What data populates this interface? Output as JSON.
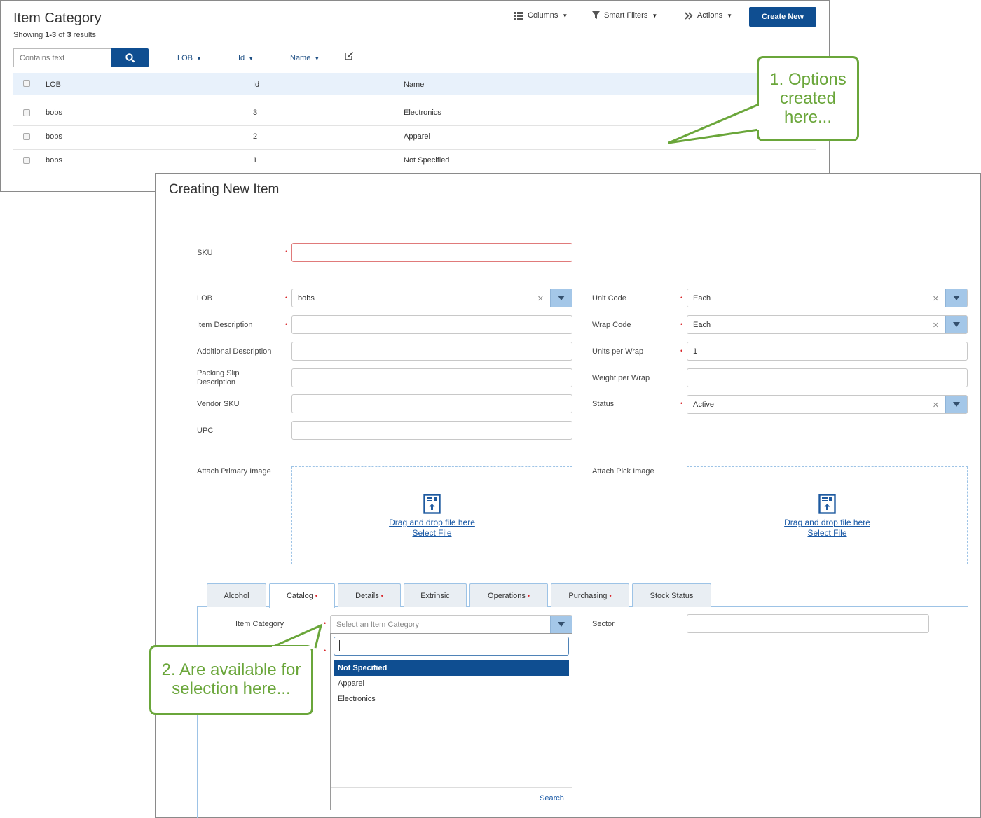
{
  "item_category": {
    "title": "Item Category",
    "showing_prefix": "Showing ",
    "showing_range": "1-3",
    "showing_mid": " of ",
    "showing_total": "3",
    "showing_suffix": " results",
    "toolbar": {
      "columns": "Columns",
      "smart_filters": "Smart Filters",
      "actions": "Actions",
      "create_new": "Create New"
    },
    "search": {
      "placeholder": "Contains text"
    },
    "filters": [
      "LOB",
      "Id",
      "Name"
    ],
    "columns": [
      "LOB",
      "Id",
      "Name"
    ],
    "rows": [
      {
        "lob": "bobs",
        "id": "3",
        "name": "Electronics"
      },
      {
        "lob": "bobs",
        "id": "2",
        "name": "Apparel"
      },
      {
        "lob": "bobs",
        "id": "1",
        "name": "Not Specified"
      }
    ]
  },
  "callouts": {
    "one": [
      "1. Options",
      "created",
      "here..."
    ],
    "two": [
      "2. Are available for",
      "selection here..."
    ]
  },
  "new_item": {
    "title": "Creating New Item",
    "fields": {
      "sku": {
        "label": "SKU",
        "value": ""
      },
      "lob": {
        "label": "LOB",
        "value": "bobs"
      },
      "item_description": {
        "label": "Item Description",
        "value": ""
      },
      "additional_description": {
        "label": "Additional Description",
        "value": ""
      },
      "packing_slip_description": {
        "label_line1": "Packing Slip",
        "label_line2": "Description",
        "value": ""
      },
      "vendor_sku": {
        "label": "Vendor SKU",
        "value": ""
      },
      "upc": {
        "label": "UPC",
        "value": ""
      },
      "unit_code": {
        "label": "Unit Code",
        "value": "Each"
      },
      "wrap_code": {
        "label": "Wrap Code",
        "value": "Each"
      },
      "units_per_wrap": {
        "label": "Units per Wrap",
        "value": "1"
      },
      "weight_per_wrap": {
        "label": "Weight per Wrap",
        "value": ""
      },
      "status": {
        "label": "Status",
        "value": "Active"
      },
      "primary_image": {
        "label": "Attach Primary Image",
        "drag_text": "Drag and drop file here ",
        "select_text": "Select File"
      },
      "pick_image": {
        "label": "Attach Pick Image",
        "drag_text": "Drag and drop file here ",
        "select_text": "Select File"
      }
    },
    "tabs": [
      {
        "label": "Alcohol",
        "required": false
      },
      {
        "label": "Catalog",
        "required": true
      },
      {
        "label": "Details",
        "required": true
      },
      {
        "label": "Extrinsic",
        "required": false
      },
      {
        "label": "Operations",
        "required": true
      },
      {
        "label": "Purchasing",
        "required": true
      },
      {
        "label": "Stock Status",
        "required": false
      }
    ],
    "active_tab": "Catalog",
    "catalog": {
      "item_category_label": "Item Category",
      "item_category_placeholder": "Select an Item Category",
      "sector_label": "Sector",
      "sector_value": "",
      "options": [
        "Not Specified",
        "Apparel",
        "Electronics"
      ],
      "selected_option": "Not Specified",
      "search_link": "Search"
    }
  },
  "colors": {
    "primary_button": "#0f4e91",
    "table_header": "#e8f1fb",
    "callout_green": "#6aa63a",
    "select_arrow_bg": "#a4c7e8",
    "required_star": "#d9262a"
  }
}
